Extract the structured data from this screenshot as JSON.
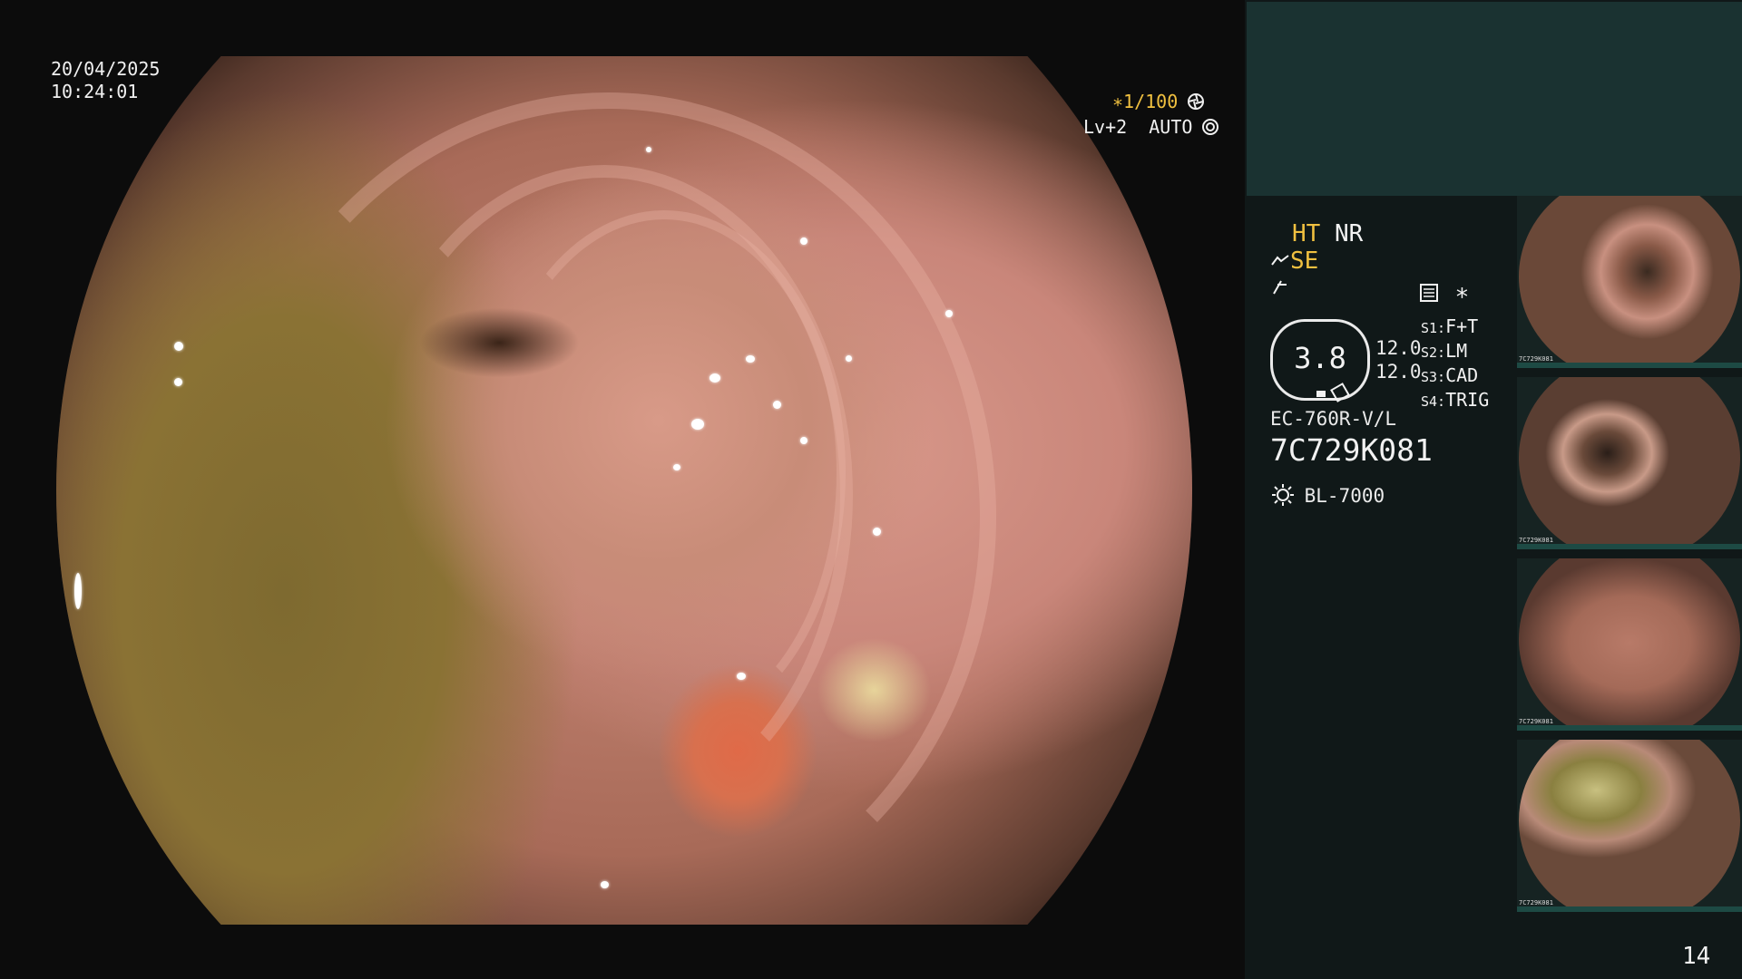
{
  "osd": {
    "date": "20/04/2025",
    "time": "10:24:01",
    "shutter": "∗1/100",
    "shutter_icon": "aperture-icon",
    "level": "Lv+2  AUTO",
    "level_icon": "auto-iris-icon"
  },
  "panel": {
    "mode_ht": "HT",
    "mode_nr": "NR",
    "mode_se": "SE",
    "se_icon": "sharpness-icon",
    "filter_icon": "filter-icon",
    "settings_icon": "settings-list-icon",
    "asterisk": "∗",
    "gauge_value": "3.8",
    "value_a": "12.0",
    "value_b": "12.0",
    "switches": [
      {
        "key": "S1:",
        "value": "F+T"
      },
      {
        "key": "S2:",
        "value": "LM"
      },
      {
        "key": "S3:",
        "value": "CAD"
      },
      {
        "key": "S4:",
        "value": "TRIG"
      }
    ],
    "scope_model": "EC-760R-V/L",
    "scope_serial": "7C729K081",
    "light_source": "BL-7000",
    "light_icon": "light-source-icon",
    "page_number": "14"
  },
  "colors": {
    "accent_yellow": "#f0c040",
    "panel_bg": "#101818",
    "panel_top": "#1a3231",
    "thumb_footer": "#1d4a44"
  },
  "thumbnails": [
    {
      "id": "thumb-1",
      "caption": "7C729K081"
    },
    {
      "id": "thumb-2",
      "caption": "7C729K081"
    },
    {
      "id": "thumb-3",
      "caption": "7C729K081"
    },
    {
      "id": "thumb-4",
      "caption": "7C729K081"
    }
  ]
}
